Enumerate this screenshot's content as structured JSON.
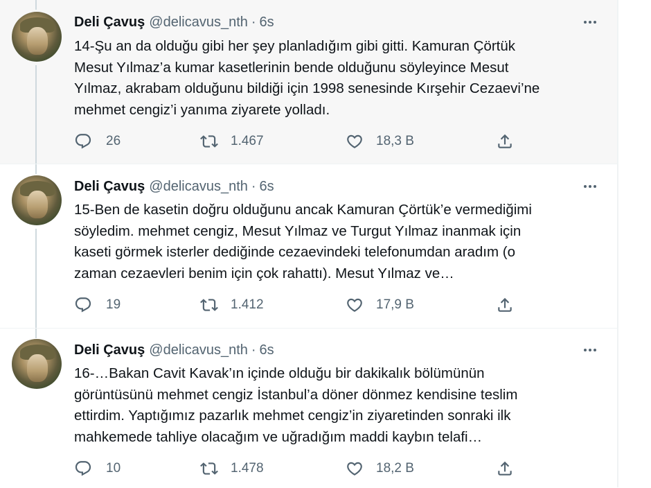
{
  "tweets": [
    {
      "author_name": "Deli Çavuş",
      "handle": "@delicavus_nth",
      "separator": "·",
      "time": "6s",
      "lines": [
        "14-Şu an da olduğu gibi her şey planladığım gibi gitti. Kamuran Çörtük",
        "Mesut Yılmaz’a kumar kasetlerinin bende olduğunu söyleyince Mesut",
        "Yılmaz, akrabam olduğunu bildiği için 1998 senesinde Kırşehir Cezaevi’ne",
        "mehmet cengiz’i yanıma ziyarete yolladı."
      ],
      "replies": "26",
      "retweets": "1.467",
      "likes": "18,3 B"
    },
    {
      "author_name": "Deli Çavuş",
      "handle": "@delicavus_nth",
      "separator": "·",
      "time": "6s",
      "lines": [
        "15-Ben de kasetin doğru olduğunu ancak Kamuran Çörtük’e vermediğimi",
        "söyledim. mehmet cengiz, Mesut Yılmaz ve Turgut Yılmaz inanmak için",
        "kaseti görmek isterler dediğinde cezaevindeki telefonumdan aradım (o",
        "zaman cezaevleri benim için çok rahattı). Mesut Yılmaz ve…"
      ],
      "replies": "19",
      "retweets": "1.412",
      "likes": "17,9 B"
    },
    {
      "author_name": "Deli Çavuş",
      "handle": "@delicavus_nth",
      "separator": "·",
      "time": "6s",
      "lines": [
        "16-…Bakan Cavit Kavak’ın içinde olduğu bir dakikalık bölümünün",
        "görüntüsünü mehmet cengiz İstanbul’a döner dönmez kendisine teslim",
        "ettirdim. Yaptığımız pazarlık mehmet cengiz’in ziyaretinden sonraki ilk",
        "mahkemede tahliye olacağım ve uğradığım maddi kaybın telafi…"
      ],
      "replies": "10",
      "retweets": "1.478",
      "likes": "18,2 B"
    }
  ],
  "icons": {
    "more": "more-icon",
    "reply": "reply-icon",
    "retweet": "retweet-icon",
    "like": "like-icon",
    "share": "share-icon"
  },
  "colors": {
    "text": "#0f1419",
    "secondary": "#536471",
    "thread_line": "#cfd9de",
    "highlight_bg": "#f7f7f7"
  }
}
